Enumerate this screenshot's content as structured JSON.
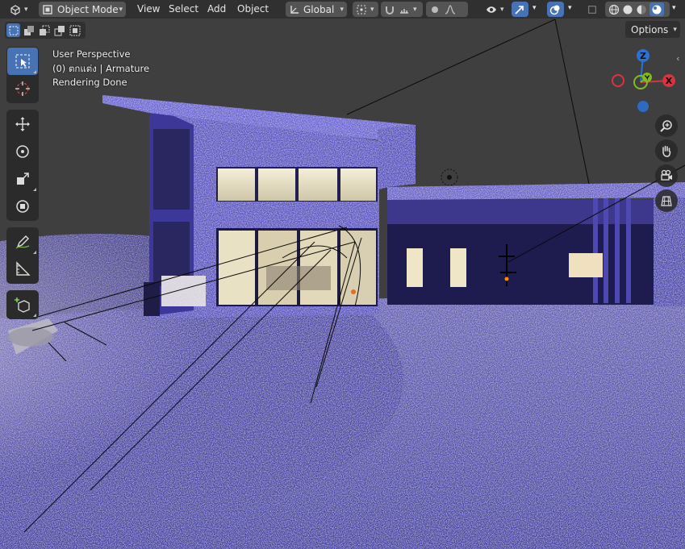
{
  "header": {
    "editor_type_icon": "viewport-3d-icon",
    "mode_label": "Object Mode",
    "menus": [
      "View",
      "Select",
      "Add",
      "Object"
    ],
    "transform_orientation": "Global",
    "shading_modes": [
      "wireframe",
      "solid",
      "material-preview",
      "rendered"
    ],
    "active_shading": "rendered"
  },
  "toolbar_row": {
    "options_label": "Options"
  },
  "viewport_info": {
    "line1": "User Perspective",
    "line2": "(0) ตกแต่ง | Armature",
    "line3": "Rendering Done"
  },
  "gizmo": {
    "z_label": "Z",
    "y_label": "Y",
    "x_label": "X",
    "colors": {
      "x": "#d8343f",
      "y": "#7fbc1e",
      "z": "#2b72d6"
    }
  },
  "tools": [
    [
      "select-box-tool",
      "cursor-tool"
    ],
    [
      "move-tool",
      "rotate-tool",
      "scale-tool",
      "transform-tool"
    ],
    [
      "annotate-tool",
      "measure-tool"
    ],
    [
      "add-cube-tool"
    ]
  ],
  "navigation": [
    "zoom-icon",
    "hand-pan-icon",
    "camera-icon",
    "grid-ortho-icon"
  ],
  "theme": {
    "accent": "#4772b3",
    "header_bg": "#303030",
    "button_bg": "#545454"
  }
}
